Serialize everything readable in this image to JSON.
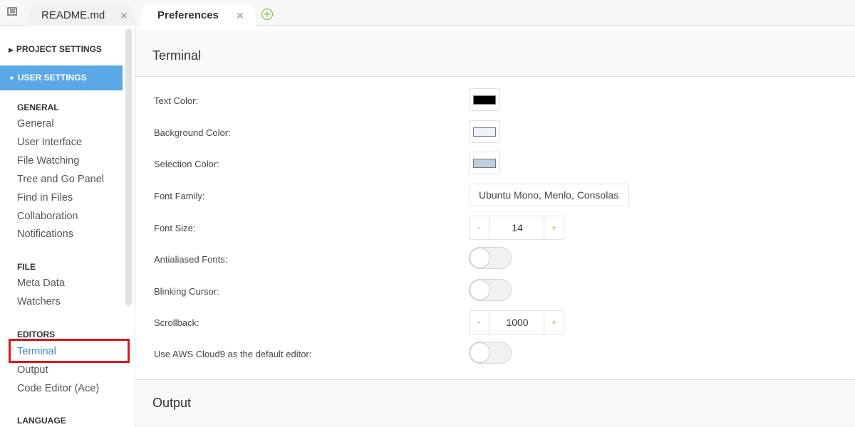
{
  "tabs": [
    {
      "label": "README.md",
      "close": "✕"
    },
    {
      "label": "Preferences",
      "close": "✕"
    }
  ],
  "sidebar": {
    "project_settings": "PROJECT SETTINGS",
    "user_settings": "USER SETTINGS",
    "groups": {
      "general": {
        "heading": "GENERAL",
        "items": [
          "General",
          "User Interface",
          "File Watching",
          "Tree and Go Panel",
          "Find in Files",
          "Collaboration",
          "Notifications"
        ]
      },
      "file": {
        "heading": "FILE",
        "items": [
          "Meta Data",
          "Watchers"
        ]
      },
      "editors": {
        "heading": "EDITORS",
        "items": [
          "Terminal",
          "Output",
          "Code Editor (Ace)"
        ]
      },
      "language": {
        "heading": "LANGUAGE"
      }
    },
    "active_item": "Terminal"
  },
  "terminal": {
    "title": "Terminal",
    "text_color_label": "Text Color:",
    "text_color": "#000000",
    "background_color_label": "Background Color:",
    "background_color": "#eef2f8",
    "selection_color_label": "Selection Color:",
    "selection_color": "#bfcfdf",
    "font_family_label": "Font Family:",
    "font_family_value": "Ubuntu Mono, Menlo, Consolas",
    "font_size_label": "Font Size:",
    "font_size_value": "14",
    "antialiased_label": "Antialiased Fonts:",
    "antialiased_on": false,
    "blinking_label": "Blinking Cursor:",
    "blinking_on": false,
    "scrollback_label": "Scrollback:",
    "scrollback_value": "1000",
    "default_editor_label": "Use AWS Cloud9 as the default editor:",
    "default_editor_on": false,
    "minus": "-",
    "plus": "+"
  },
  "output": {
    "title": "Output"
  },
  "colors": {
    "accent": "#5aa9e6",
    "active_link": "#3a87c8",
    "highlight_box": "#e0161b",
    "plus_green": "#8bc34a"
  }
}
